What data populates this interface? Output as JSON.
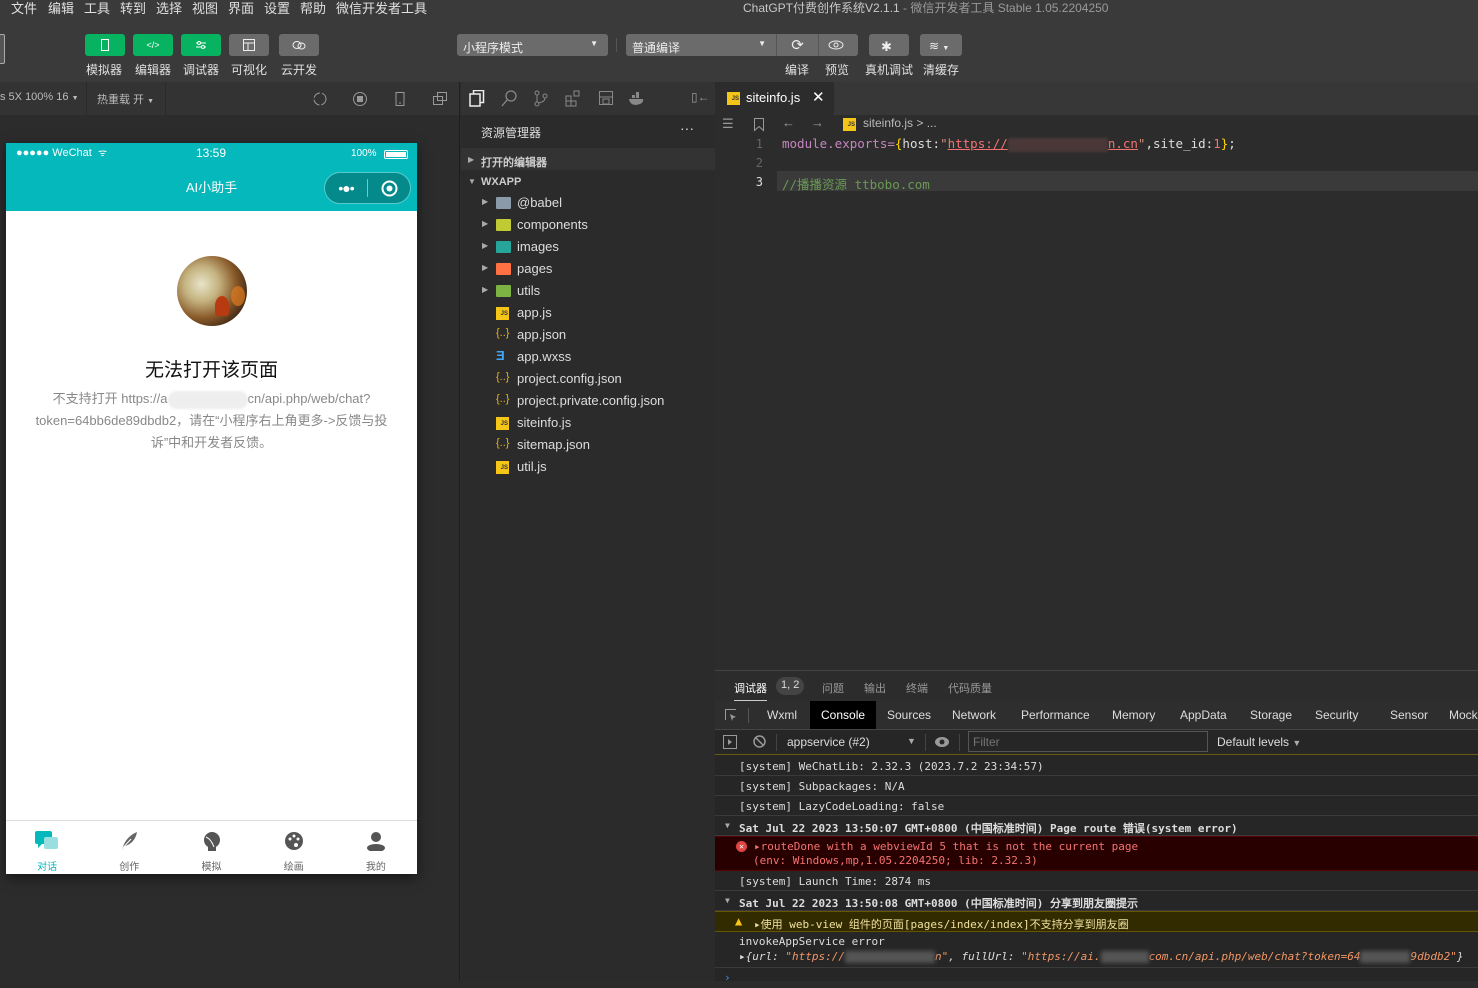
{
  "menubar": {
    "items": [
      "文件",
      "编辑",
      "工具",
      "转到",
      "选择",
      "视图",
      "界面",
      "设置",
      "帮助",
      "微信开发者工具"
    ],
    "title_project": "ChatGPT付费创作系统V2.1.1",
    "title_app": " - 微信开发者工具 Stable 1.05.2204250"
  },
  "toolbar": {
    "left_buttons": [
      {
        "label": "模拟器",
        "icon": "phone-icon",
        "active": true
      },
      {
        "label": "编辑器",
        "icon": "code-icon",
        "active": true
      },
      {
        "label": "调试器",
        "icon": "sliders-icon",
        "active": true
      },
      {
        "label": "可视化",
        "icon": "layout-icon",
        "active": false
      },
      {
        "label": "云开发",
        "icon": "cloud-icon",
        "active": false
      }
    ],
    "mode_select": "小程序模式",
    "compile_select": "普通编译",
    "right_labels": [
      "编译",
      "预览",
      "真机调试",
      "清缓存"
    ],
    "active_color": "#07b361"
  },
  "simbar": {
    "device": "s 5X 100% 16",
    "hot_reload": "热重载 开"
  },
  "phone": {
    "status": {
      "carrier": "●●●●● WeChat",
      "time": "13:59",
      "battery": "100%"
    },
    "nav_title": "AI小助手",
    "error_title": "无法打开该页面",
    "error_desc_prefix": "不支持打开 https://a",
    "error_desc_suffix": "cn/api.php/web/chat?token=64bb6de89dbdb2，请在“小程序右上角更多->反馈与投诉”中和开发者反馈。",
    "brand_color": "#05b8bb",
    "tabs": [
      {
        "label": "对话",
        "icon": "chat-icon",
        "active": true
      },
      {
        "label": "创作",
        "icon": "feather-icon",
        "active": false
      },
      {
        "label": "模拟",
        "icon": "head-icon",
        "active": false
      },
      {
        "label": "绘画",
        "icon": "palette-icon",
        "active": false
      },
      {
        "label": "我的",
        "icon": "user-icon",
        "active": false
      }
    ]
  },
  "explorer": {
    "title": "资源管理器",
    "more": "···",
    "open_editors": "打开的编辑器",
    "project": "WXAPP",
    "files": [
      {
        "name": "@babel",
        "type": "folder",
        "color": "#8a9aa8"
      },
      {
        "name": "components",
        "type": "folder",
        "color": "#c0ca33"
      },
      {
        "name": "images",
        "type": "folder",
        "color": "#26a69a"
      },
      {
        "name": "pages",
        "type": "folder",
        "color": "#ff7043"
      },
      {
        "name": "utils",
        "type": "folder",
        "color": "#7cb342"
      },
      {
        "name": "app.js",
        "type": "js"
      },
      {
        "name": "app.json",
        "type": "json"
      },
      {
        "name": "app.wxss",
        "type": "css"
      },
      {
        "name": "project.config.json",
        "type": "json"
      },
      {
        "name": "project.private.config.json",
        "type": "json"
      },
      {
        "name": "siteinfo.js",
        "type": "js"
      },
      {
        "name": "sitemap.json",
        "type": "json"
      },
      {
        "name": "util.js",
        "type": "js"
      }
    ]
  },
  "editor": {
    "tab": "siteinfo.js",
    "breadcrumb": "siteinfo.js > ...",
    "lines": [
      {
        "num": "1"
      },
      {
        "num": "2"
      },
      {
        "num": "3"
      }
    ],
    "code_line1": {
      "kw": "module.exports",
      "eq": "=",
      "ob": "{",
      "key": "host:",
      "q": "\"",
      "url_start": "https://",
      "url_end": "n.cn",
      "rest": ",site_id:",
      "num": "1",
      "cb": "}",
      ";": ";"
    },
    "code_line3": "//播播资源 ttbobo.com"
  },
  "debugger": {
    "tabs": [
      "调试器",
      "问题",
      "输出",
      "终端",
      "代码质量"
    ],
    "badge": "1, 2",
    "devtools_tabs": [
      "Wxml",
      "Console",
      "Sources",
      "Network",
      "Performance",
      "Memory",
      "AppData",
      "Storage",
      "Security",
      "Sensor",
      "Mock"
    ],
    "active_devtab": "Console",
    "context": "appservice (#2)",
    "filter_placeholder": "Filter",
    "levels": "Default levels",
    "logs": {
      "l1": "[system] WeChatLib: 2.32.3 (2023.7.2 23:34:57)",
      "l2": "[system] Subpackages: N/A",
      "l3": "[system] LazyCodeLoading: false",
      "g1": "Sat Jul 22 2023 13:50:07 GMT+0800 (中国标准时间) Page route 错误(system error)",
      "e1a": "▸routeDone with a webviewId 5 that is not the current page",
      "e1b": "(env: Windows,mp,1.05.2204250; lib: 2.32.3)",
      "l4": "[system] Launch Time: 2874 ms",
      "g2": "Sat Jul 22 2023 13:50:08 GMT+0800 (中国标准时间) 分享到朋友圈提示",
      "w1": "▸使用 web-view 组件的页面[pages/index/index]不支持分享到朋友圈",
      "l5": "invokeAppService error",
      "obj_prefix": "▸{url: ",
      "obj_url": "\"https://",
      "obj_url_end": "n\"",
      "obj_mid": ", fullUrl: ",
      "obj_full_a": "\"https://ai.",
      "obj_full_b": "com.cn/api.php/web/chat?token=64",
      "obj_full_c": "9dbdb2\"",
      "obj_end": "}"
    }
  }
}
